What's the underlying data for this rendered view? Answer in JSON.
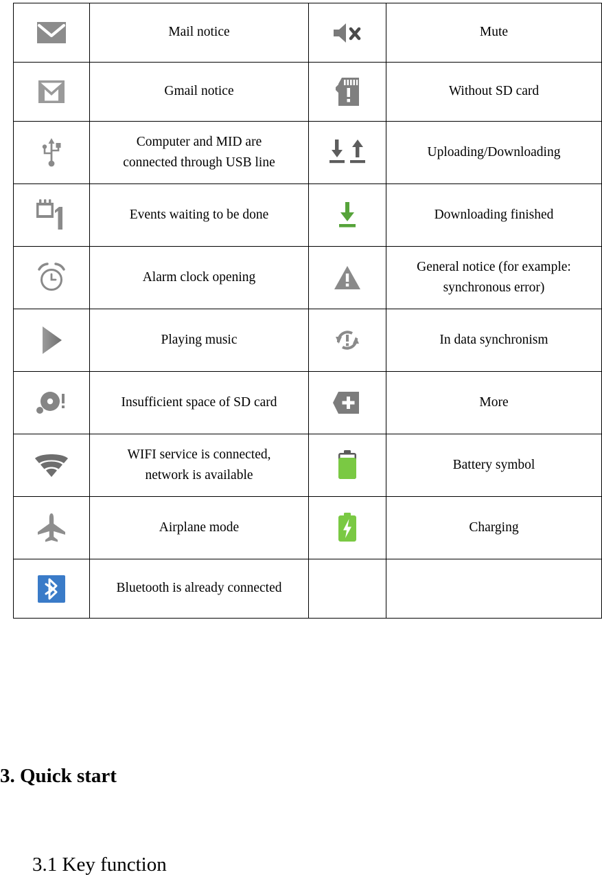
{
  "document": {
    "type": "user-manual-page",
    "table": {
      "name": "status-notification-icons",
      "rows": [
        {
          "left_icon": "mail-envelope-icon",
          "left_text": [
            "Mail notice"
          ],
          "right_icon": "speaker-mute-icon",
          "right_text": [
            "Mute"
          ]
        },
        {
          "left_icon": "gmail-icon",
          "left_text": [
            "Gmail notice"
          ],
          "right_icon": "sd-card-missing-icon",
          "right_text": [
            "Without SD card"
          ]
        },
        {
          "left_icon": "usb-icon",
          "left_text": [
            "Computer and MID are",
            "connected through USB line"
          ],
          "right_icon": "upload-download-arrows-icon",
          "right_text": [
            "Uploading/Downloading"
          ]
        },
        {
          "left_icon": "calendar-event-icon",
          "left_text": [
            "Events waiting to be done"
          ],
          "right_icon": "download-finished-icon",
          "right_text": [
            "Downloading finished"
          ]
        },
        {
          "left_icon": "alarm-clock-icon",
          "left_text": [
            "Alarm clock opening"
          ],
          "right_icon": "warning-triangle-icon",
          "right_text": [
            "General notice (for example:",
            "synchronous error)"
          ]
        },
        {
          "left_icon": "play-music-icon",
          "left_text": [
            "Playing music"
          ],
          "right_icon": "data-sync-icon",
          "right_text": [
            "In data synchronism"
          ]
        },
        {
          "left_icon": "sd-card-full-icon",
          "left_text": [
            "Insufficient space of SD card"
          ],
          "right_icon": "more-plus-icon",
          "right_text": [
            "More"
          ]
        },
        {
          "left_icon": "wifi-icon",
          "left_text": [
            "WIFI service is connected,",
            "network is available"
          ],
          "right_icon": "battery-icon",
          "right_text": [
            "Battery symbol"
          ]
        },
        {
          "left_icon": "airplane-mode-icon",
          "left_text": [
            "Airplane mode"
          ],
          "right_icon": "battery-charging-icon",
          "right_text": [
            "Charging"
          ]
        },
        {
          "left_icon": "bluetooth-icon",
          "left_text": [
            "Bluetooth is already connected"
          ],
          "right_icon": "",
          "right_text": [
            ""
          ]
        }
      ]
    },
    "headings": {
      "chapter": "3. Quick start",
      "section": "3.1 Key function"
    },
    "colors": {
      "icon_gray": "#7d7d7d",
      "icon_gray_dark": "#636363",
      "green": "#6db33f",
      "battery_green": "#7ac943",
      "bluetooth_blue": "#3a7bc8",
      "border": "#000000",
      "text": "#000000"
    }
  }
}
